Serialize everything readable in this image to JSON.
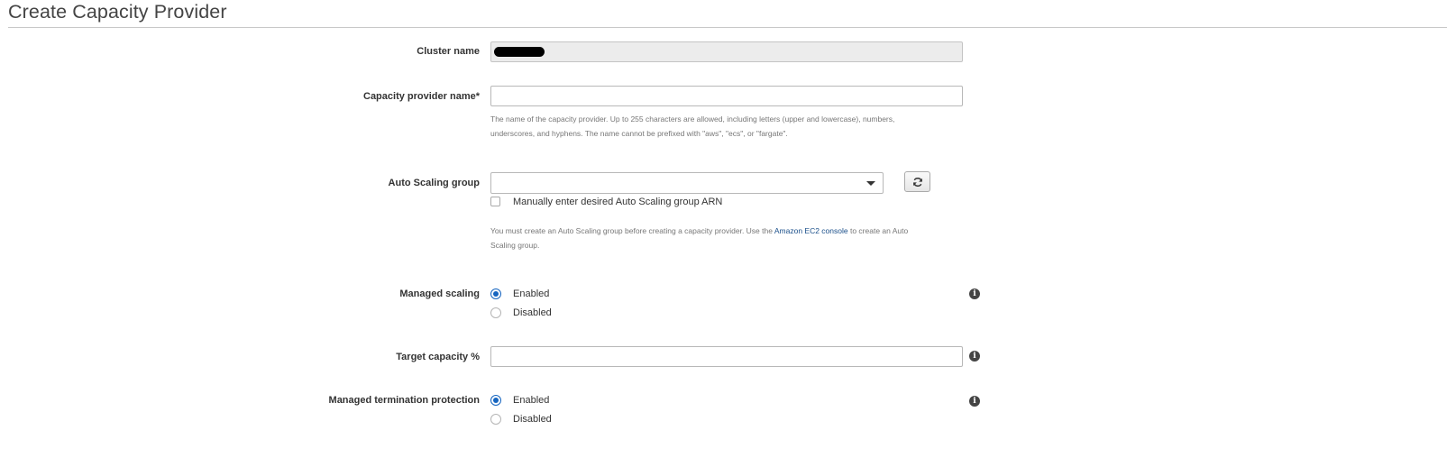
{
  "page": {
    "title": "Create Capacity Provider"
  },
  "cluster_name": {
    "label": "Cluster name",
    "value": ""
  },
  "capacity_provider_name": {
    "label": "Capacity provider name*",
    "value": "",
    "help_line1": "The name of the capacity provider. Up to 255 characters are allowed, including letters (upper and lowercase), numbers,",
    "help_line2": "underscores, and hyphens. The name cannot be prefixed with \"aws\", \"ecs\", or \"fargate\"."
  },
  "auto_scaling_group": {
    "label": "Auto Scaling group",
    "selected": "",
    "manual_arn_label": "Manually enter desired Auto Scaling group ARN",
    "help_prefix": "You must create an Auto Scaling group before creating a capacity provider. Use the ",
    "help_link": "Amazon EC2 console",
    "help_suffix": " to create an Auto",
    "help_line2": "Scaling group.",
    "refresh_icon": "refresh-icon"
  },
  "managed_scaling": {
    "label": "Managed scaling",
    "options": [
      "Enabled",
      "Disabled"
    ],
    "selected": "Enabled"
  },
  "target_capacity": {
    "label": "Target capacity %",
    "value": ""
  },
  "managed_termination_protection": {
    "label": "Managed termination protection",
    "options": [
      "Enabled",
      "Disabled"
    ],
    "selected": "Enabled"
  },
  "icons": {
    "info": "info-icon"
  },
  "colors": {
    "accent": "#1565c0",
    "link": "#1a4f8a"
  }
}
